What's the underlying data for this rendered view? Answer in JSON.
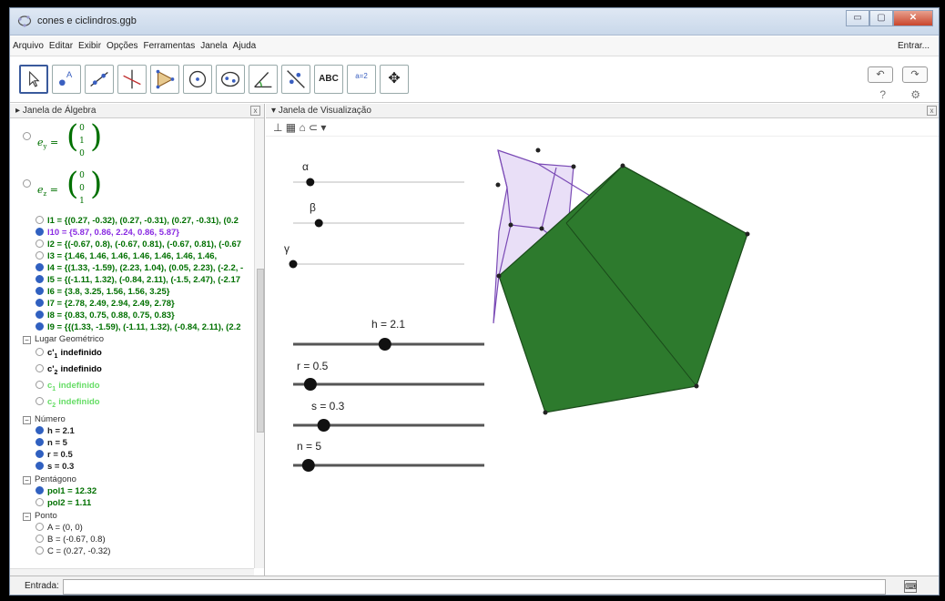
{
  "window": {
    "title": "cones e ciclindros.ggb",
    "buttons": {
      "minimize": "▭",
      "maximize": "▢",
      "close": "✕"
    }
  },
  "menu": {
    "items": [
      "Arquivo",
      "Editar",
      "Exibir",
      "Opções",
      "Ferramentas",
      "Janela",
      "Ajuda"
    ],
    "signin": "Entrar..."
  },
  "toolbar": {
    "tools": [
      "move",
      "point",
      "line",
      "perpendicular",
      "polygon",
      "circle",
      "conic",
      "angle",
      "reflect",
      "text",
      "slider",
      "move-graphics"
    ],
    "text_tool": "ABC",
    "slider_tool": "a=2",
    "undo": "↶",
    "redo": "↷",
    "help": "?",
    "settings": "⚙"
  },
  "algebra": {
    "title": "Janela de Álgebra",
    "close": "x",
    "vectors": [
      {
        "name": "e",
        "sub": "y",
        "v": [
          "0",
          "1",
          "0"
        ]
      },
      {
        "name": "e",
        "sub": "z",
        "v": [
          "0",
          "0",
          "1"
        ]
      }
    ],
    "lists": [
      {
        "text": "l1 = {(0.27, -0.32), (0.27, -0.31), (0.27, -0.31), (0.2",
        "on": false,
        "color": "#007000"
      },
      {
        "text": "l10 = {5.87, 0.86, 2.24, 0.86, 5.87}",
        "on": true,
        "color": "#8a2be2"
      },
      {
        "text": "l2 = {(-0.67, 0.8), (-0.67, 0.81), (-0.67, 0.81), (-0.67",
        "on": false,
        "color": "#007000"
      },
      {
        "text": "l3 = {1.46, 1.46, 1.46, 1.46, 1.46, 1.46, 1.46,",
        "on": false,
        "color": "#007000"
      },
      {
        "text": "l4 = {(1.33, -1.59), (2.23, 1.04), (0.05, 2.23), (-2.2, -",
        "on": true,
        "color": "#007000"
      },
      {
        "text": "l5 = {(-1.11, 1.32), (-0.84, 2.11), (-1.5, 2.47), (-2.17",
        "on": true,
        "color": "#007000"
      },
      {
        "text": "l6 = {3.8, 3.25, 1.56, 1.56, 3.25}",
        "on": true,
        "color": "#007000"
      },
      {
        "text": "l7 = {2.78, 2.49, 2.94, 2.49, 2.78}",
        "on": true,
        "color": "#007000"
      },
      {
        "text": "l8 = {0.83, 0.75, 0.88, 0.75, 0.83}",
        "on": true,
        "color": "#007000"
      },
      {
        "text": "l9 = {{(1.33, -1.59), (-1.11, 1.32), (-0.84, 2.11), (2.2",
        "on": true,
        "color": "#007000"
      }
    ],
    "groups": {
      "lugar": "Lugar Geométrico",
      "numero": "Número",
      "pentagono": "Pentágono",
      "ponto": "Ponto"
    },
    "locus": [
      {
        "name": "c'",
        "sub": "1",
        "val": "indefinido",
        "color": "#000000"
      },
      {
        "name": "c'",
        "sub": "2",
        "val": "indefinido",
        "color": "#000000"
      },
      {
        "name": "c",
        "sub": "1",
        "val": "indefinido",
        "color": "#66dd66"
      },
      {
        "name": "c",
        "sub": "2",
        "val": "indefinido",
        "color": "#66dd66"
      }
    ],
    "numbers": [
      "h = 2.1",
      "n = 5",
      "r = 0.5",
      "s = 0.3"
    ],
    "polygons": [
      {
        "text": "pol1 = 12.32",
        "on": true
      },
      {
        "text": "pol2 = 1.11",
        "on": false
      }
    ],
    "points": [
      "A = (0, 0)",
      "B = (-0.67, 0.8)",
      "C = (0.27, -0.32)"
    ]
  },
  "graphics": {
    "title": "Janela de Visualização",
    "toolbar_icons": "⊥ ▦ ⌂ ⊂ ▾",
    "sliders": [
      {
        "label": "α",
        "value": 0.1
      },
      {
        "label": "β",
        "value": 0.15
      },
      {
        "label": "γ",
        "value": 0.0
      },
      {
        "label": "h = 2.1",
        "value": 0.48
      },
      {
        "label": "r = 0.5",
        "value": 0.09
      },
      {
        "label": "s = 0.3",
        "value": 0.16
      },
      {
        "label": "n = 5",
        "value": 0.08
      }
    ],
    "colors": {
      "pentagon": "#2d7a2d",
      "small_poly": "#e9dff7",
      "small_stroke": "#7a4ab5"
    }
  },
  "input": {
    "label": "Entrada:",
    "keyboard": "⌨"
  }
}
